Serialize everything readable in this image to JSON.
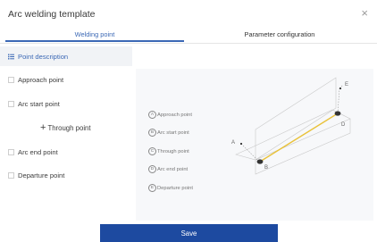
{
  "dialog": {
    "title": "Arc welding template",
    "close_symbol": "×"
  },
  "tabs": [
    {
      "label": "Welding point",
      "active": true
    },
    {
      "label": "Parameter configuration",
      "active": false
    }
  ],
  "sidebar": {
    "items": [
      {
        "label": "Point description",
        "icon": "list-icon",
        "active": true
      },
      {
        "label": "Approach point",
        "icon": "point-icon",
        "active": false
      },
      {
        "label": "Arc start point",
        "icon": "point-icon",
        "active": false
      },
      {
        "label": "Arc end point",
        "icon": "point-icon",
        "active": false
      },
      {
        "label": "Departure point",
        "icon": "point-icon",
        "active": false
      }
    ],
    "through_point": {
      "symbol": "+",
      "label": "Through point"
    }
  },
  "legend": [
    {
      "badge": "A",
      "label": "Approach point"
    },
    {
      "badge": "B",
      "label": "Arc start point"
    },
    {
      "badge": "C",
      "label": "Through point"
    },
    {
      "badge": "D",
      "label": "Arc end point"
    },
    {
      "badge": "E",
      "label": "Departure point"
    }
  ],
  "diagram": {
    "labels": {
      "a": "A",
      "b": "B",
      "c": "C",
      "d": "D",
      "e": "E"
    },
    "colors": {
      "weld_line": "#e9c23a",
      "plate": "#c8c8c8",
      "point": "#333333"
    }
  },
  "footer": {
    "save_label": "Save",
    "save_color": "#1d4aa0"
  }
}
